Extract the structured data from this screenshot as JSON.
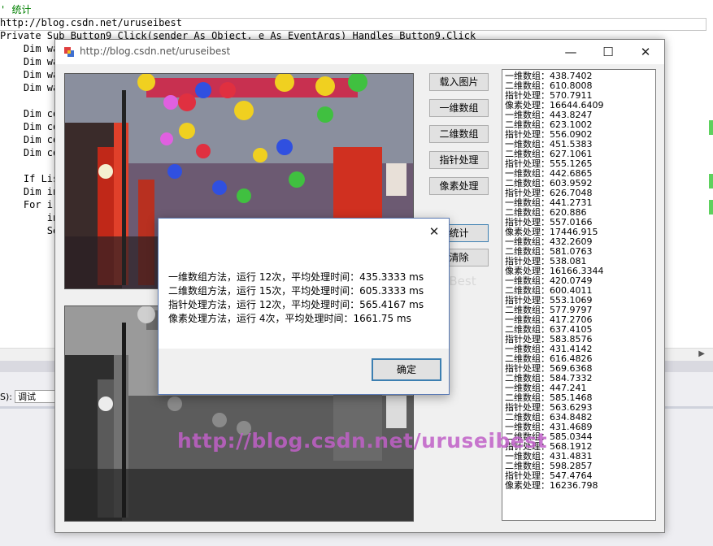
{
  "ide": {
    "code_lines": [
      {
        "text": "' 统计",
        "cls": "cm"
      },
      {
        "text": "http://blog.csdn.net/uruseibest",
        "cls": ""
      },
      {
        "text": "Private Sub Button9_Click(sender As Object, e As EventArgs) Handles Button9.Click",
        "cls": ""
      },
      {
        "text": "    Dim wa",
        "cls": ""
      },
      {
        "text": "    Dim wa",
        "cls": ""
      },
      {
        "text": "    Dim wa",
        "cls": ""
      },
      {
        "text": "    Dim wa",
        "cls": ""
      },
      {
        "text": "",
        "cls": ""
      },
      {
        "text": "    Dim co",
        "cls": ""
      },
      {
        "text": "    Dim co",
        "cls": ""
      },
      {
        "text": "    Dim co",
        "cls": ""
      },
      {
        "text": "    Dim co",
        "cls": ""
      },
      {
        "text": "",
        "cls": ""
      },
      {
        "text": "    If Lis",
        "cls": ""
      },
      {
        "text": "    Dim in",
        "cls": ""
      },
      {
        "text": "    For i",
        "cls": ""
      },
      {
        "text": "        in",
        "cls": ""
      },
      {
        "text": "        Se",
        "cls": ""
      }
    ],
    "bottom_label": "S):",
    "bottom_combo": "调试",
    "scroll_arrow": "▶"
  },
  "window": {
    "title": "http://blog.csdn.net/uruseibest",
    "minimize": "—",
    "maximize": "☐",
    "close": "✕",
    "buttons": {
      "load_image": "载入图片",
      "one_dim": "一维数组",
      "two_dim": "二维数组",
      "pointer": "指针处理",
      "pixel": "像素处理",
      "stats": "统计",
      "clear": "清除"
    },
    "log_lines": [
      "一维数组：438.7402",
      "二维数组：610.8008",
      "指针处理：570.7911",
      "像素处理：16644.6409",
      "一维数组：443.8247",
      "二维数组：623.1002",
      "指针处理：556.0902",
      "一维数组：451.5383",
      "二维数组：627.1061",
      "指针处理：555.1265",
      "一维数组：442.6865",
      "二维数组：603.9592",
      "指针处理：626.7048",
      "一维数组：441.2731",
      "二维数组：620.886",
      "指针处理：557.0166",
      "像素处理：17446.915",
      "一维数组：432.2609",
      "二维数组：581.0763",
      "指针处理：538.081",
      "像素处理：16166.3344",
      "一维数组：420.0749",
      "二维数组：600.4011",
      "指针处理：553.1069",
      "二维数组：577.9797",
      "一维数组：417.2706",
      "二维数组：637.4105",
      "指针处理：583.8576",
      "一维数组：431.4142",
      "二维数组：616.4826",
      "指针处理：569.6368",
      "二维数组：584.7332",
      "一维数组：447.241",
      "二维数组：585.1468",
      "指针处理：563.6293",
      "二维数组：634.8482",
      "一维数组：431.4689",
      "二维数组：585.0344",
      "指针处理：568.1912",
      "一维数组：431.4831",
      "二维数组：598.2857",
      "指针处理：547.4764",
      "像素处理：16236.798"
    ]
  },
  "dialog": {
    "close": "✕",
    "lines": [
      "一维数组方法，运行 12次，平均处理时间：435.3333 ms",
      "二维数组方法，运行 15次，平均处理时间：605.3333 ms",
      "指针处理方法，运行 12次，平均处理时间：565.4167 ms",
      "像素处理方法，运行 4次，平均处理时间：1661.75 ms"
    ],
    "ok": "确定"
  },
  "watermark": "http://blog.csdn.net/uruseibest",
  "watermark_small": "uruseiBest"
}
